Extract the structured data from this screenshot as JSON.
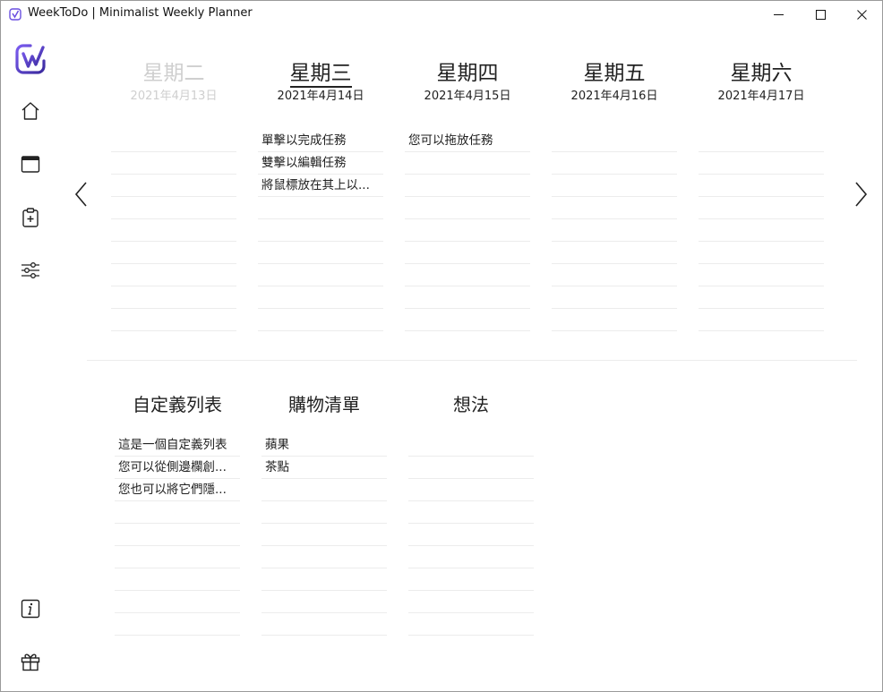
{
  "window": {
    "title": "WeekToDo | Minimalist Weekly Planner"
  },
  "sidebar": {
    "items": [
      {
        "icon": "home-icon"
      },
      {
        "icon": "calendar-icon"
      },
      {
        "icon": "clipboard-add-icon"
      },
      {
        "icon": "sliders-icon"
      },
      {
        "icon": "info-icon"
      },
      {
        "icon": "gift-icon"
      }
    ]
  },
  "days": [
    {
      "name": "星期二",
      "date": "2021年4月13日",
      "state": "past",
      "tasks": [
        "",
        "",
        "",
        "",
        "",
        "",
        "",
        "",
        ""
      ]
    },
    {
      "name": "星期三",
      "date": "2021年4月14日",
      "state": "today",
      "tasks": [
        "單擊以完成任務",
        "雙擊以編輯任務",
        "將鼠標放在其上以...",
        "",
        "",
        "",
        "",
        "",
        ""
      ]
    },
    {
      "name": "星期四",
      "date": "2021年4月15日",
      "state": "future",
      "tasks": [
        "您可以拖放任務",
        "",
        "",
        "",
        "",
        "",
        "",
        "",
        ""
      ]
    },
    {
      "name": "星期五",
      "date": "2021年4月16日",
      "state": "future",
      "tasks": [
        "",
        "",
        "",
        "",
        "",
        "",
        "",
        "",
        ""
      ]
    },
    {
      "name": "星期六",
      "date": "2021年4月17日",
      "state": "future",
      "tasks": [
        "",
        "",
        "",
        "",
        "",
        "",
        "",
        "",
        ""
      ]
    }
  ],
  "lists": [
    {
      "name": "自定義列表",
      "tasks": [
        "這是一個自定義列表",
        "您可以從側邊欄創...",
        "您也可以將它們隱...",
        "",
        "",
        "",
        "",
        "",
        ""
      ]
    },
    {
      "name": "購物清單",
      "tasks": [
        "蘋果",
        "茶點",
        "",
        "",
        "",
        "",
        "",
        "",
        ""
      ]
    },
    {
      "name": "想法",
      "tasks": [
        "",
        "",
        "",
        "",
        "",
        "",
        "",
        "",
        ""
      ]
    }
  ],
  "colors": {
    "accent": "#5b3fd6",
    "accent2": "#7b5cf0",
    "past_text": "#cfcfcf",
    "line": "#ececec"
  }
}
